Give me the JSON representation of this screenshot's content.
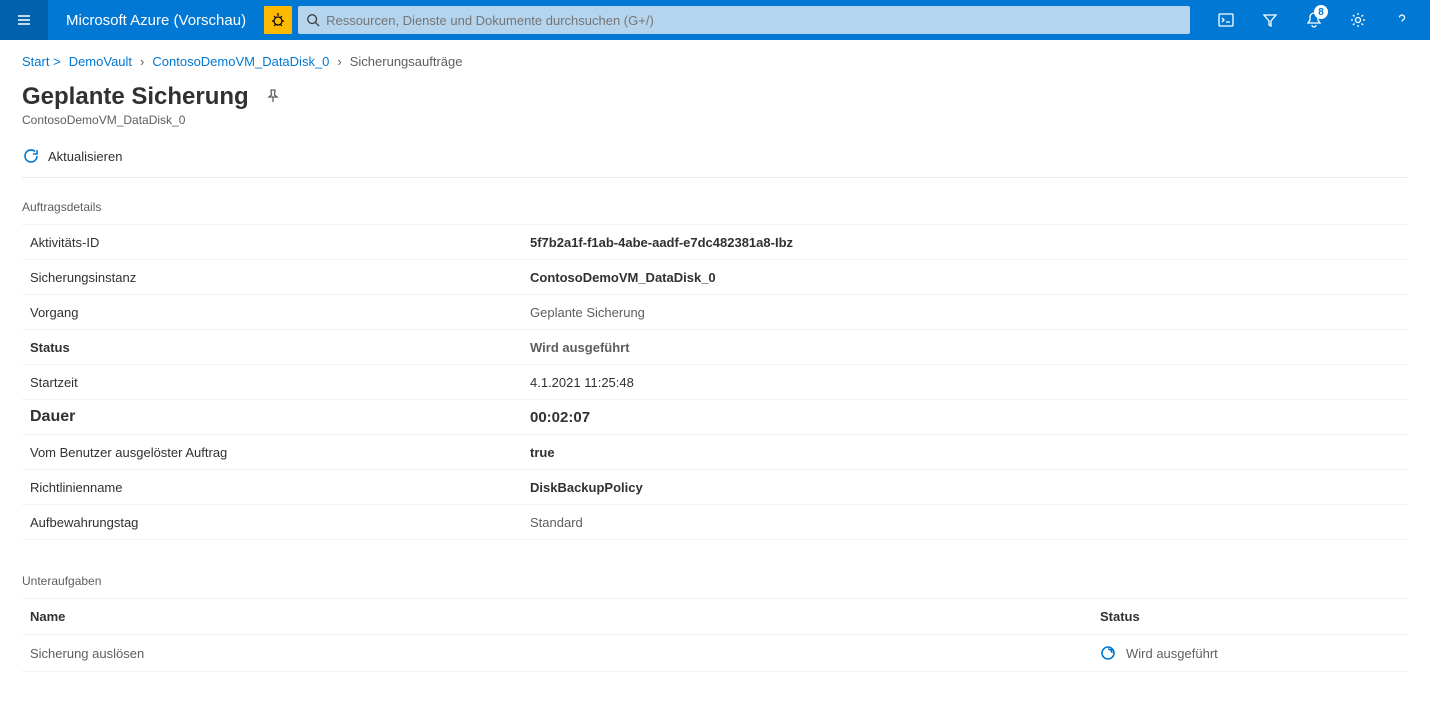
{
  "header": {
    "brand": "Microsoft Azure (Vorschau)",
    "search_placeholder": "Ressourcen, Dienste und Dokumente durchsuchen (G+/)",
    "notifications_count": "8"
  },
  "breadcrumb": {
    "start": "Start",
    "items": [
      "DemoVault",
      "ContosoDemoVM_DataDisk_0"
    ],
    "current": "Sicherungsaufträge"
  },
  "page": {
    "title": "Geplante Sicherung",
    "subtitle": "ContosoDemoVM_DataDisk_0"
  },
  "toolbar": {
    "refresh_label": "Aktualisieren"
  },
  "details": {
    "section_title": "Auftragsdetails",
    "rows": [
      {
        "label": "Aktivitäts-ID",
        "value": "5f7b2a1f-f1ab-4abe-aadf-e7dc482381a8-Ibz",
        "style": "bold"
      },
      {
        "label": "Sicherungsinstanz",
        "value": "ContosoDemoVM_DataDisk_0",
        "style": "bold"
      },
      {
        "label": "Vorgang",
        "value": "Geplante Sicherung",
        "style": "muted"
      },
      {
        "label": "Status",
        "value": "Wird ausgeführt",
        "style": "fw600 muted"
      },
      {
        "label": "Startzeit",
        "value": "4.1.2021 11:25:48",
        "style": ""
      },
      {
        "label": "Dauer",
        "value": "00:02:07",
        "style": "big"
      },
      {
        "label": "Vom Benutzer ausgelöster Auftrag",
        "value": "true",
        "style": "bold"
      },
      {
        "label": "Richtlinienname",
        "value": "DiskBackupPolicy",
        "style": "bold"
      },
      {
        "label": "Aufbewahrungstag",
        "value": "Standard",
        "style": "muted"
      }
    ]
  },
  "subtasks": {
    "section_title": "Unteraufgaben",
    "headers": {
      "name": "Name",
      "status": "Status"
    },
    "rows": [
      {
        "name": "Sicherung auslösen",
        "status": "Wird ausgeführt"
      }
    ]
  }
}
